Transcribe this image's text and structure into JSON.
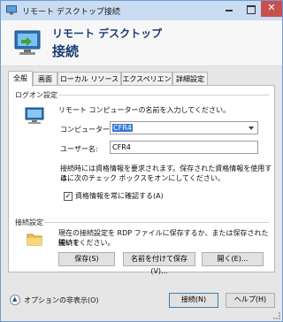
{
  "window": {
    "title": "リモート デスクトップ接続"
  },
  "header": {
    "line1": "リモート デスクトップ",
    "line2": "接続"
  },
  "tabs": [
    {
      "label": "全般",
      "active": true
    },
    {
      "label": "画面",
      "active": false
    },
    {
      "label": "ローカル リソース",
      "active": false
    },
    {
      "label": "エクスペリエンス",
      "active": false
    },
    {
      "label": "詳細設定",
      "active": false
    }
  ],
  "logon": {
    "group_label": "ログオン設定",
    "prompt": "リモート コンピューターの名前を入力してください。",
    "computer_label": "コンピューター(C):",
    "computer_value": "CFR4",
    "user_label": "ユーザー名:",
    "user_value": "CFR4",
    "info_line1": "接続時には資格情報を要求されます。保存された資格情報を使用するに",
    "info_line2": "は、次のチェック ボックスをオンにしてください。",
    "always_ask_label": "資格情報を常に確認する(A)",
    "always_ask_checked": true
  },
  "connection": {
    "group_label": "接続設定",
    "text_line1": "現在の接続設定を RDP ファイルに保存するか、または保存された接続を",
    "text_line2": "開いてください。",
    "save_label": "保存(S)",
    "save_as_label": "名前を付けて保存(V)...",
    "open_label": "開く(E)..."
  },
  "footer": {
    "options_label": "オプションの非表示(O)",
    "connect_label": "接続(N)",
    "help_label": "ヘルプ(H)"
  },
  "colors": {
    "titlebar": "#c9dcf2",
    "close_button": "#c7504f",
    "header_text": "#1a3c73",
    "selection": "#3a78d4"
  },
  "icons": {
    "title": "rdp-monitor-icon",
    "header": "rdp-computer-icon",
    "logon": "computer-monitor-icon",
    "connection": "folder-icon",
    "options": "chevron-up-icon"
  }
}
